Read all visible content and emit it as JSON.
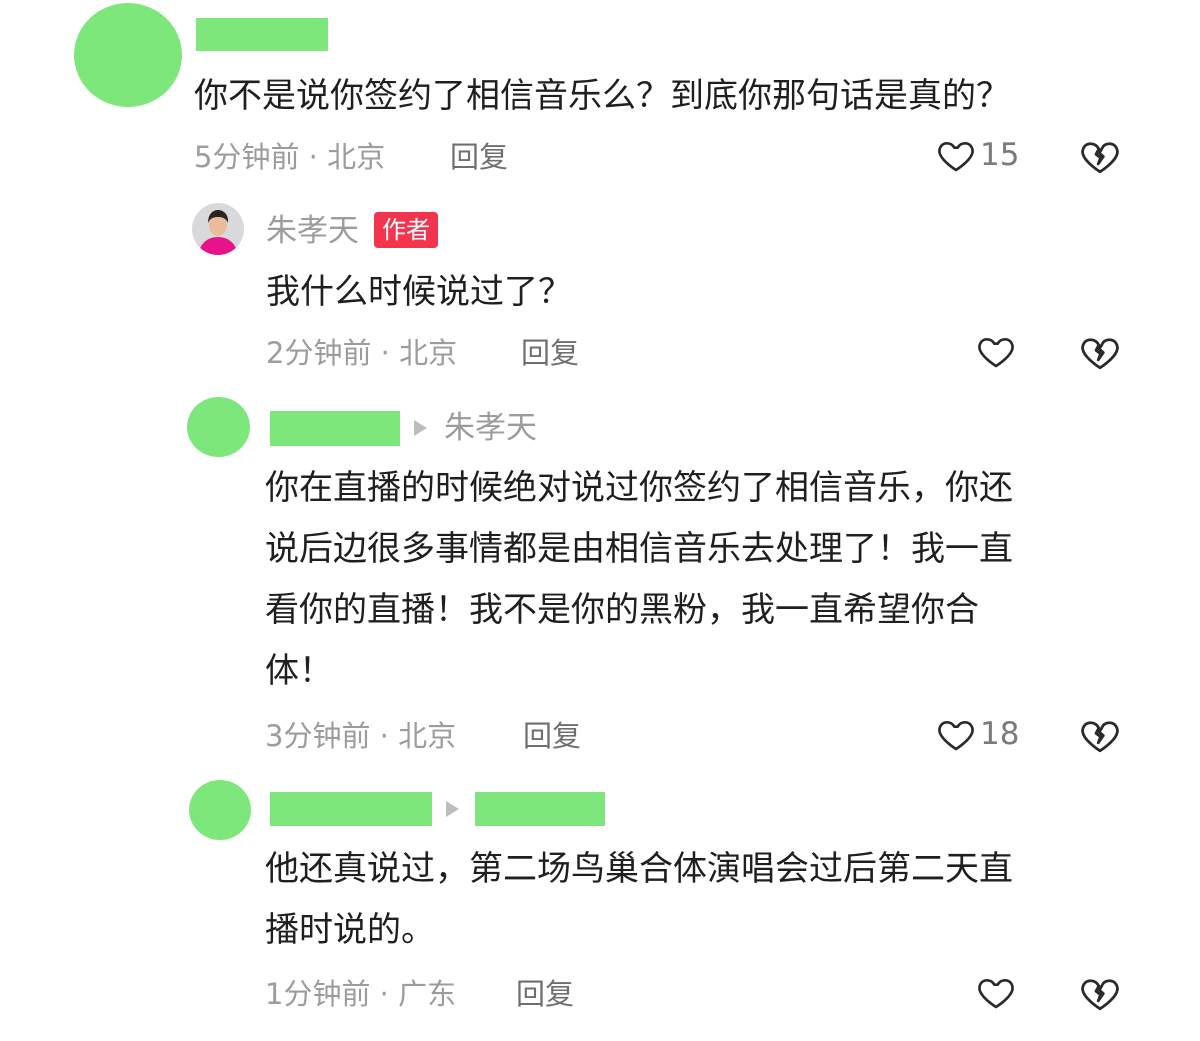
{
  "colors": {
    "redaction": "#7ee77c",
    "author_badge": "#f2344f"
  },
  "comments": [
    {
      "user": "",
      "text_lines": [
        "你不是说你签约了相信音乐么？到底你那句话是真的？"
      ],
      "time": "5分钟前 · 北京",
      "reply_label": "回复",
      "likes": "15"
    },
    {
      "user": "朱孝天",
      "badge": "作者",
      "text_lines": [
        "我什么时候说过了？"
      ],
      "time": "2分钟前 · 北京",
      "reply_label": "回复",
      "likes": ""
    },
    {
      "user": "",
      "reply_to": "朱孝天",
      "text_lines": [
        "你在直播的时候绝对说过你签约了相信音乐，你还",
        "说后边很多事情都是由相信音乐去处理了！我一直",
        "看你的直播！我不是你的黑粉，我一直希望你合",
        "体！"
      ],
      "time": "3分钟前 · 北京",
      "reply_label": "回复",
      "likes": "18"
    },
    {
      "user": "",
      "reply_to": "",
      "text_lines": [
        "他还真说过，第二场鸟巢合体演唱会过后第二天直",
        "播时说的。"
      ],
      "time": "1分钟前 · 广东",
      "reply_label": "回复",
      "likes": ""
    }
  ],
  "icons": {
    "like": "heart-outline-icon",
    "dislike": "broken-heart-icon",
    "reply_arrow": "triangle-right-icon"
  }
}
